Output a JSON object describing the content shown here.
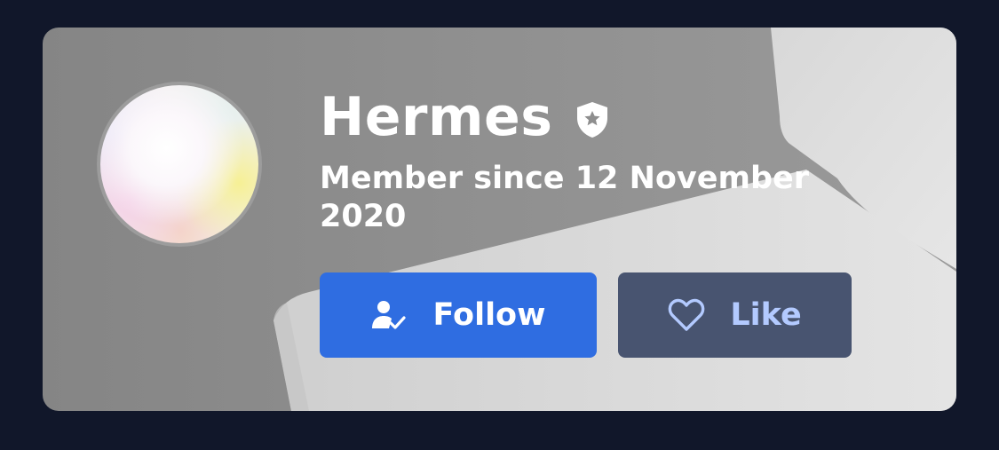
{
  "profile": {
    "name": "Hermes",
    "member_since": "Member since 12 November 2020",
    "badge_icon": "shield-star-icon",
    "avatar": "avatar"
  },
  "actions": {
    "follow_label": "Follow",
    "follow_icon": "user-check-icon",
    "like_label": "Like",
    "like_icon": "heart-icon"
  },
  "colors": {
    "page_background": "#11172a",
    "card_background": "#8e8e8e",
    "follow_button": "#2f6de1",
    "like_button": "#485470",
    "like_text": "#b3caff",
    "text": "#ffffff"
  }
}
